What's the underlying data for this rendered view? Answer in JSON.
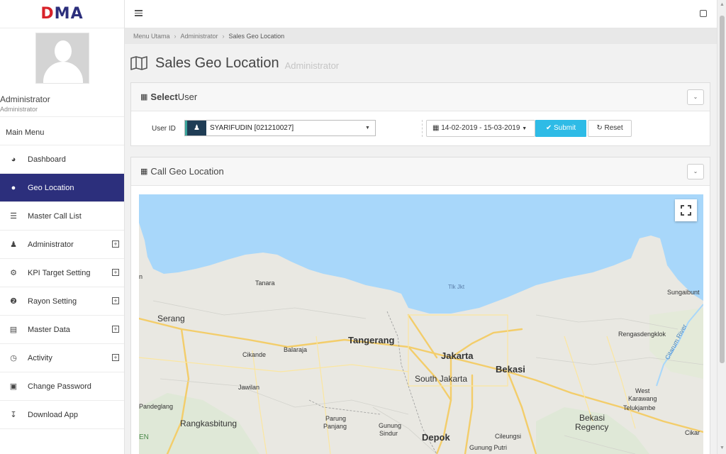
{
  "brand": {
    "logo_text_a": "D",
    "logo_text_b": "MA"
  },
  "profile": {
    "name": "Administrator",
    "role": "Administrator"
  },
  "sidebar": {
    "header": "Main Menu",
    "items": [
      {
        "label": "Dashboard",
        "icon": "dashboard-icon",
        "expandable": false
      },
      {
        "label": "Geo Location",
        "icon": "map-marker-icon",
        "expandable": false,
        "active": true
      },
      {
        "label": "Master Call List",
        "icon": "list-icon",
        "expandable": false
      },
      {
        "label": "Administrator",
        "icon": "user-icon",
        "expandable": true
      },
      {
        "label": "KPI Target Setting",
        "icon": "cogs-icon",
        "expandable": true
      },
      {
        "label": "Rayon Setting",
        "icon": "pin-icon",
        "expandable": true
      },
      {
        "label": "Master Data",
        "icon": "database-icon",
        "expandable": true
      },
      {
        "label": "Activity",
        "icon": "clock-icon",
        "expandable": true
      },
      {
        "label": "Change Password",
        "icon": "lock-icon",
        "expandable": false
      },
      {
        "label": "Download App",
        "icon": "download-icon",
        "expandable": false
      }
    ]
  },
  "breadcrumb": {
    "items": [
      "Menu Utama",
      "Administrator",
      "Sales Geo Location"
    ]
  },
  "page": {
    "title": "Sales Geo Location",
    "subtitle": "Administrator"
  },
  "select_user": {
    "title_bold": "Select",
    "title_rest": " User",
    "user_id_label": "User ID",
    "user_value": "SYARIFUDIN [021210027]",
    "date_range": "14-02-2019 - 15-03-2019",
    "submit_label": "Submit",
    "reset_label": "Reset"
  },
  "geo_panel": {
    "title": "Call Geo Location"
  },
  "map_labels": {
    "tanara": "Tanara",
    "tlk_jkt": "Tlk Jkt",
    "sungaibunt": "Sungaibunt",
    "serang": "Serang",
    "tangerang": "Tangerang",
    "jakarta": "Jakarta",
    "bekasi": "Bekasi",
    "cikande": "Cikande",
    "balaraja": "Balaraja",
    "south_jakarta": "South Jakarta",
    "rengas": "Rengasdengklok",
    "citarum": "Citarum River",
    "jawilan": "Jawilan",
    "pandeglang": "Pandeglang",
    "rangkasbitung": "Rangkasbitung",
    "parung": "Parung",
    "panjang": "Panjang",
    "gunung_sindur": "Gunung",
    "sindur": "Sindur",
    "depok": "Depok",
    "cileungsi": "Cileungsi",
    "gunung_putri": "Gunung Putri",
    "west": "West",
    "karawang": "Karawang",
    "telukjambe": "Telukjambe",
    "bekasi_regency_1": "Bekasi",
    "bekasi_regency_2": "Regency",
    "cikar": "Cikar",
    "en": "EN",
    "n": "n"
  },
  "colors": {
    "brand": "#2c2f7c",
    "brand_red": "#d8232a",
    "accent": "#2ebbe6",
    "sea": "#a8d7fa"
  }
}
